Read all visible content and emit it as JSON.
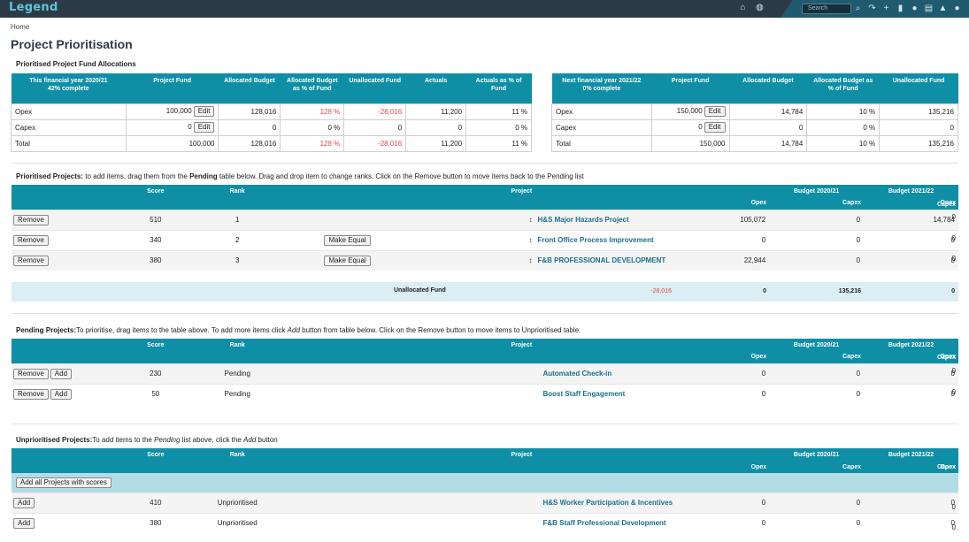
{
  "app": {
    "logo": "Legend",
    "search_placeholder": "Search"
  },
  "breadcrumb": "Home",
  "title": "Project Prioritisation",
  "fund_section_title": "Prioritised Project Fund Allocations",
  "fund_this": {
    "headers": [
      "This financial year 2020/21\n42% complete",
      "Project Fund",
      "Allocated Budget",
      "Allocated Budget\nas % of Fund",
      "Unallocated Fund",
      "Actuals",
      "Actuals as % of\nFund"
    ],
    "rows": [
      {
        "label": "Opex",
        "fund": "100,000",
        "alloc": "128,016",
        "pct": "128 %",
        "unalloc": "-28,016",
        "actuals": "11,200",
        "act_pct": "11 %"
      },
      {
        "label": "Capex",
        "fund": "0",
        "alloc": "0",
        "pct": "0 %",
        "unalloc": "0",
        "actuals": "0",
        "act_pct": "0 %"
      },
      {
        "label": "Total",
        "fund": "100,000",
        "alloc": "128,016",
        "pct": "128 %",
        "unalloc": "-28,016",
        "actuals": "11,200",
        "act_pct": "11 %"
      }
    ]
  },
  "fund_next": {
    "headers": [
      "Next financial year 2021/22\n0% complete",
      "Project Fund",
      "Allocated Budget",
      "Allocated Budget as\n% of Fund",
      "Unallocated Fund"
    ],
    "rows": [
      {
        "label": "Opex",
        "fund": "150,000",
        "alloc": "14,784",
        "pct": "10 %",
        "unalloc": "135,216"
      },
      {
        "label": "Capex",
        "fund": "0",
        "alloc": "0",
        "pct": "0 %",
        "unalloc": "0"
      },
      {
        "label": "Total",
        "fund": "150,000",
        "alloc": "14,784",
        "pct": "10 %",
        "unalloc": "135,216"
      }
    ]
  },
  "buttons": {
    "edit": "Edit",
    "remove": "Remove",
    "add": "Add",
    "make_equal": "Make Equal",
    "add_all": "Add all Projects with scores"
  },
  "columns": {
    "score": "Score",
    "rank": "Rank",
    "project": "Project",
    "budget_2021": "Budget 2020/21",
    "budget_2122": "Budget 2021/22",
    "opex": "Opex",
    "capex": "Capex"
  },
  "prioritised": {
    "title_bold": "Prioritised Projects:",
    "title_rest": " to add items, drag them from the ",
    "title_bold2": "Pending",
    "title_rest2": " table below. Drag and drop item to change ranks. Click on the Remove button to move items back to the Pending list",
    "rows": [
      {
        "score": "510",
        "rank": "1",
        "project": "H&S Major Hazards Project",
        "o1": "105,072",
        "c1": "0",
        "o2": "14,784",
        "c2": "0"
      },
      {
        "score": "340",
        "rank": "2",
        "project": "Front Office Process Improvement",
        "o1": "0",
        "c1": "0",
        "o2": "0",
        "c2": "0"
      },
      {
        "score": "380",
        "rank": "3",
        "project": "F&B PROFESSIONAL DEVELOPMENT",
        "o1": "22,944",
        "c1": "0",
        "o2": "0",
        "c2": "0"
      }
    ],
    "unallocated": {
      "label": "Unallocated Fund",
      "o1": "-28,016",
      "c1": "0",
      "o2": "135,216",
      "c2": "0"
    }
  },
  "pending": {
    "title_bold": "Pending Projects:",
    "title_rest": "To prioritise, drag items to the table above. To add more items click ",
    "title_italic": "Add",
    "title_rest2": " button from table below. Click on the Remove button to move items to Unprioritised table.",
    "rows": [
      {
        "score": "230",
        "rank": "Pending",
        "project": "Automated Check-in",
        "o1": "0",
        "c1": "0",
        "o2": "0",
        "c2": "0"
      },
      {
        "score": "50",
        "rank": "Pending",
        "project": "Boost Staff Engagement",
        "o1": "0",
        "c1": "0",
        "o2": "0",
        "c2": "0"
      }
    ]
  },
  "unprioritised": {
    "title_bold": "Unprioritised Projects:",
    "title_rest": "To add items to the ",
    "title_italic": "Pending",
    "title_rest2": " list above, click the ",
    "title_italic2": "Add",
    "title_rest3": " button",
    "rows": [
      {
        "score": "410",
        "rank": "Unprioritised",
        "project": "H&S Worker Participation & Incentives",
        "o1": "0",
        "c1": "0",
        "o2": "0",
        "c2": "0"
      },
      {
        "score": "380",
        "rank": "Unprioritised",
        "project": "F&B Staff Professional Development",
        "o1": "0",
        "c1": "0",
        "o2": "0",
        "c2": "0"
      }
    ]
  }
}
